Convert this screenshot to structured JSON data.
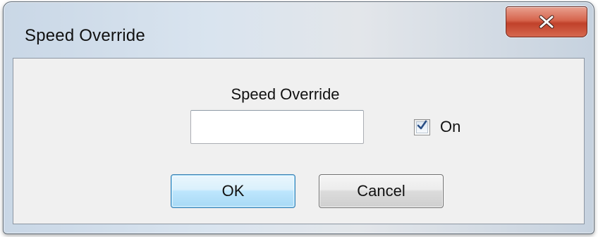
{
  "window": {
    "title": "Speed Override"
  },
  "close_button": {
    "glyph": "x",
    "icon": "close-icon"
  },
  "form": {
    "field_label": "Speed Override",
    "speed_value": "",
    "speed_placeholder": "",
    "checkbox_label": "On",
    "checkbox_checked": true
  },
  "buttons": {
    "ok_label": "OK",
    "cancel_label": "Cancel"
  },
  "colors": {
    "close_red": "#c0412a",
    "default_button_blue": "#3c7fb1",
    "check_mark": "#2a4f86"
  }
}
